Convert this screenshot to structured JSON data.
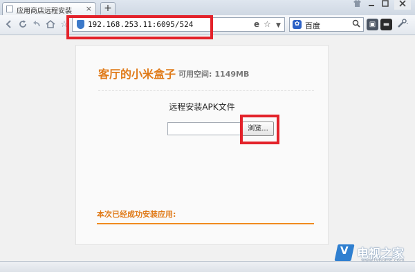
{
  "browser": {
    "tab_title": "应用商店远程安装",
    "tab_close": "×",
    "new_tab": "+",
    "url": "192.168.253.11:6095/524",
    "search_engine": "百度"
  },
  "page": {
    "box_name": "客厅的小米盒子",
    "space_label": "可用空间:",
    "space_value": "1149MB",
    "section_title": "远程安装APK文件",
    "browse_label": "浏览...",
    "installed_title": "本次已经成功安装应用:"
  },
  "watermark": {
    "brand": "电视之家",
    "logo_letter": "V",
    "url": "www.tvhome.com"
  },
  "colors": {
    "accent_orange": "#e07a18",
    "annotation_red": "#e3222a"
  }
}
